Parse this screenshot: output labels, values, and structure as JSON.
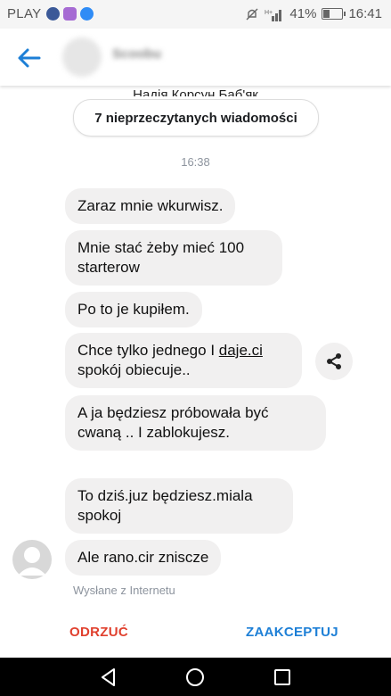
{
  "status_bar": {
    "carrier": "PLAY",
    "battery_text": "41%",
    "time": "16:41",
    "battery_level": 0.41,
    "app_icons": [
      "facebook-icon",
      "instagram-icon",
      "messenger-icon"
    ]
  },
  "header": {
    "back_icon": "arrow-left-icon",
    "contact_name": "Scoobu"
  },
  "conversation": {
    "previous_name": "Надія Корсун Баб'як",
    "unread_label": "7 nieprzeczytanych wiadomości",
    "timestamp": "16:38",
    "messages": [
      {
        "text": "Zaraz  mnie wkurwisz."
      },
      {
        "text": "Mnie stać żeby mieć 100 starterow"
      },
      {
        "text": "Po to je kupiłem."
      },
      {
        "text_before": "Chce tylko jednego I ",
        "link": "daje.ci",
        "text_after": " spokój obiecuje.."
      },
      {
        "text": "A ja będziesz próbowała być cwaną .. I zablokujesz."
      },
      {
        "text": "To dziś.juz będziesz.miala spokoj"
      },
      {
        "text": "Ale rano.cir zniscze"
      }
    ],
    "sent_via": "Wysłane z Internetu"
  },
  "actions": {
    "reject_label": "ODRZUĆ",
    "accept_label": "ZAAKCEPTUJ"
  },
  "colors": {
    "accent": "#1d7fd6",
    "reject": "#e0402e",
    "bubble": "#f1f0f0"
  }
}
